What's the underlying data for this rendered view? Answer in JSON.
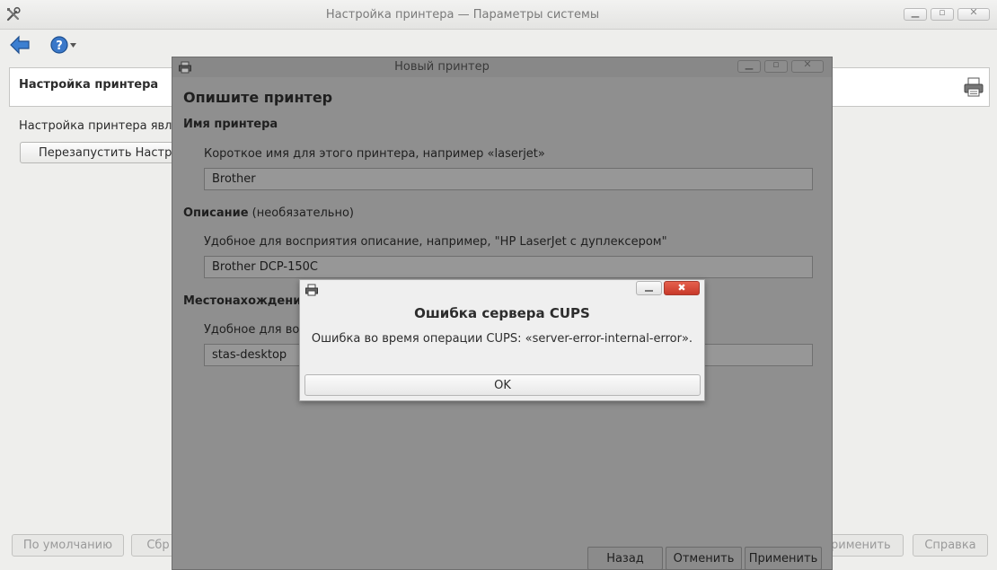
{
  "main_window": {
    "title": "Настройка принтера — Параметры системы",
    "header_title": "Настройка принтера",
    "info_text": "Настройка принтера являет",
    "restart_button": "Перезапустить Настрой",
    "bottom_buttons": {
      "defaults": "По умолчанию",
      "reset": "Сбр",
      "apply": "рименить",
      "help": "Справка"
    },
    "icons": {
      "app": "tools-icon",
      "back": "back-arrow-icon",
      "help": "help-icon",
      "printer": "printer-icon"
    }
  },
  "new_printer_dialog": {
    "title": "Новый принтер",
    "heading": "Опишите принтер",
    "name_section": {
      "label": "Имя принтера",
      "hint": "Короткое имя для этого принтера, например «laserjet»",
      "value": "Brother"
    },
    "description_section": {
      "label": "Описание",
      "optional": "(необязательно)",
      "hint": "Удобное для восприятия описание, например, \"HP LaserJet с дуплексером\"",
      "value": "Brother DCP-150C"
    },
    "location_section": {
      "label": "Местонахождение (",
      "hint": "Удобное для восп",
      "value": "stas-desktop"
    },
    "buttons": {
      "back": "Назад",
      "cancel": "Отменить",
      "apply": "Применить"
    }
  },
  "error_dialog": {
    "title": "Ошибка сервера CUPS",
    "message": "Ошибка во время операции CUPS: «server-error-internal-error».",
    "ok": "OK",
    "close_glyph": "✖"
  }
}
